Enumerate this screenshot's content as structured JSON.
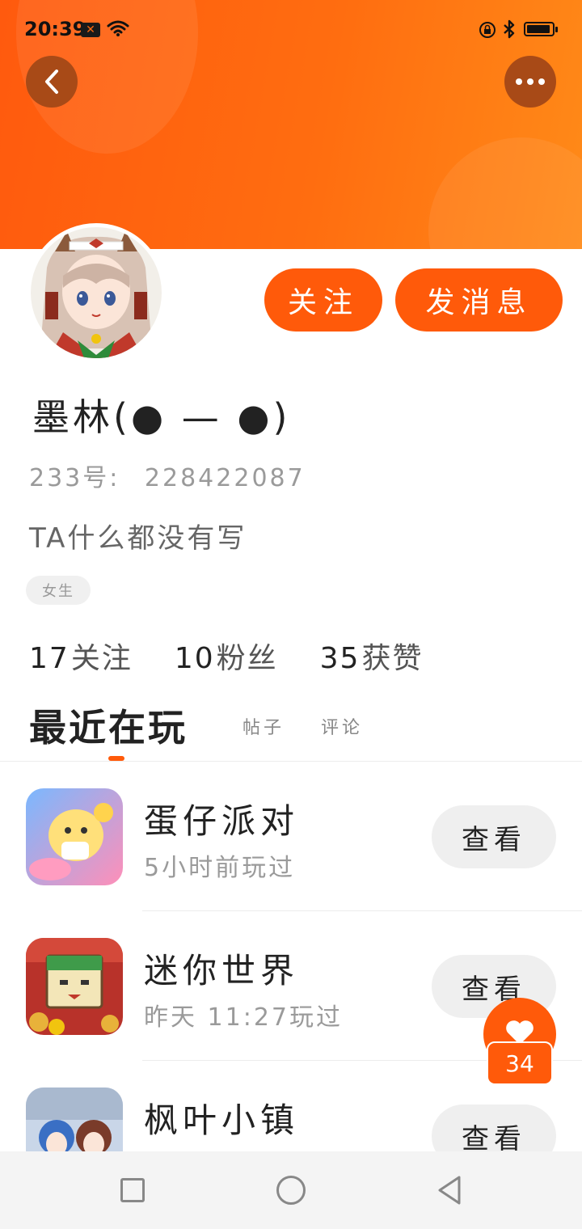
{
  "status_bar": {
    "time": "20:39",
    "icons": [
      "notification-icon",
      "wifi-icon",
      "lock-rotation-icon",
      "bluetooth-icon",
      "battery-icon"
    ]
  },
  "header": {
    "back_icon": "chevron-left-icon",
    "more_icon": "more-dots-icon"
  },
  "profile": {
    "follow_label": "关注",
    "message_label": "发消息",
    "username": "墨林(● — ●)",
    "uid_label": "233号:",
    "uid_value": "228422087",
    "bio": "TA什么都没有写",
    "gender_tag": "女生",
    "stats": [
      {
        "num": "17",
        "label": "关注"
      },
      {
        "num": "10",
        "label": "粉丝"
      },
      {
        "num": "35",
        "label": "获赞"
      }
    ]
  },
  "tabs": {
    "active": "最近在玩",
    "posts": "帖子",
    "comments": "评论"
  },
  "games": [
    {
      "name": "蛋仔派对",
      "time": "5小时前玩过",
      "action": "查看"
    },
    {
      "name": "迷你世界",
      "time": "昨天 11:27玩过",
      "action": "查看"
    },
    {
      "name": "枫叶小镇",
      "time": "",
      "action": "查看"
    }
  ],
  "like": {
    "icon": "heart-icon",
    "count": "34"
  },
  "nav_bar": {
    "icons": [
      "recent-apps-icon",
      "home-icon",
      "back-icon"
    ]
  },
  "colors": {
    "accent": "#ff5a0a",
    "header_start": "#ff5a0e",
    "header_end": "#ff8a18"
  }
}
